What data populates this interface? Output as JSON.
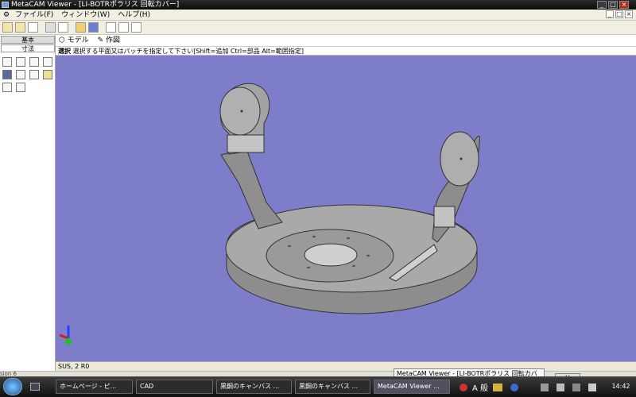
{
  "window": {
    "title": "MetaCAM Viewer - [LI-BOTRポラリス 回転カバー]",
    "minimize": "_",
    "maximize": "□",
    "close": "×"
  },
  "menu": {
    "items": [
      "ファイル(F)",
      "ウィンドウ(W)",
      "ヘルプ(H)"
    ],
    "mdi_minimize": "_",
    "mdi_restore": "□",
    "mdi_close": "×"
  },
  "left_panel": {
    "basic_label": "基本",
    "dimension_label": "寸法"
  },
  "view_tabs": {
    "model": "モデル",
    "drawing": "作図"
  },
  "hint": {
    "mode": "選択",
    "text": "選択する平面又はパッチを指定して下さい[Shift=追加 Ctrl=部品 Alt=範囲指定]"
  },
  "status": {
    "text": "SUS, 2 R0"
  },
  "side_label": "sion 6",
  "tooltip": {
    "text": "MetaCAM Viewer - [LI-BOTRポラリス 回転カバー]",
    "close": "×"
  },
  "taskbar": {
    "tasks": [
      "ホームページ - ピ...",
      "CAD",
      "黒鋼のキャンバス ...",
      "黒鋼のキャンバス ...",
      "MetaCAM Viewer ..."
    ],
    "ime": "A 般",
    "clock": "14:42"
  },
  "colors": {
    "viewport": "#7d7dc9",
    "part": "#9a9a9a",
    "taskbar": "#1a1a1a"
  }
}
